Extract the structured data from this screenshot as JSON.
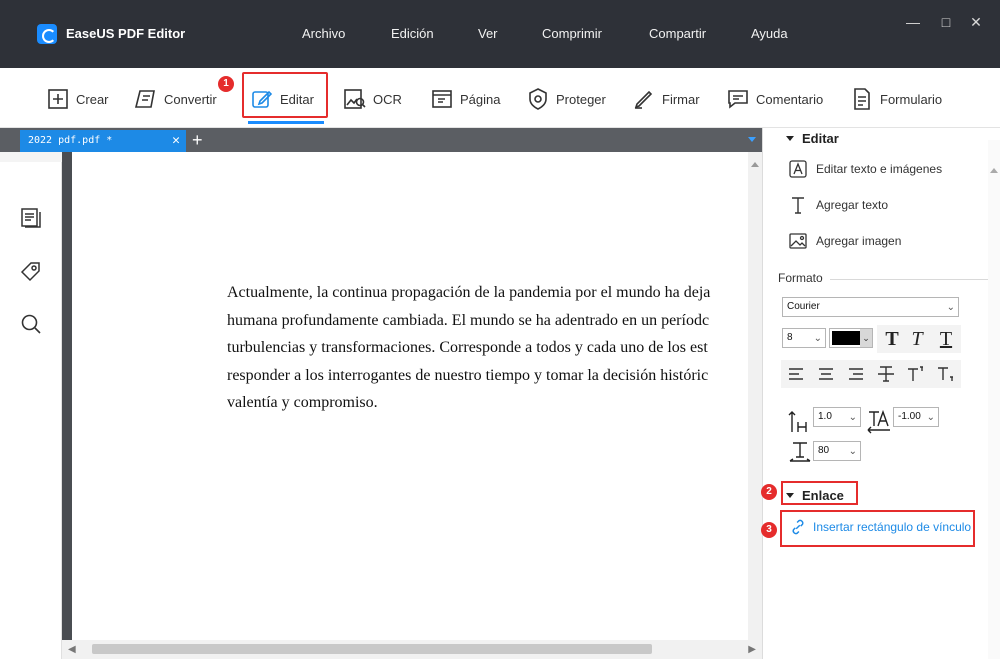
{
  "app": {
    "title": "EaseUS PDF Editor",
    "menu": [
      "Archivo",
      "Edición",
      "Ver",
      "Comprimir",
      "Compartir",
      "Ayuda"
    ]
  },
  "toolbar": {
    "tools": [
      "Crear",
      "Convertir",
      "Editar",
      "OCR",
      "Página",
      "Proteger",
      "Firmar",
      "Comentario",
      "Formulario"
    ],
    "active": "Editar"
  },
  "steps": [
    "1",
    "2",
    "3"
  ],
  "tab": {
    "name": "2022 pdf.pdf *"
  },
  "document": {
    "lines": [
      "Actualmente, la continua propagación de la pandemia por el mundo ha deja",
      "humana profundamente cambiada. El mundo se ha adentrado en un períodc",
      "turbulencias y transformaciones. Corresponde a todos y cada uno de los est",
      "responder a los interrogantes de nuestro tiempo y tomar la decisión históric",
      "valentía y compromiso."
    ]
  },
  "panel": {
    "edit_title": "Editar",
    "edit_items": [
      "Editar texto e imágenes",
      "Agregar texto",
      "Agregar imagen"
    ],
    "format_title": "Formato",
    "font_family": "Courier",
    "font_size": "8",
    "text_color": "#000000",
    "line_spacing": "1.0",
    "char_spacing": "-1.00",
    "scale": "80",
    "link_title": "Enlace",
    "link_item": "Insertar rectángulo de vínculo"
  },
  "colors": {
    "accent": "#1d8ae6",
    "highlight": "#e52c2c",
    "titlebar": "#2e3138"
  }
}
